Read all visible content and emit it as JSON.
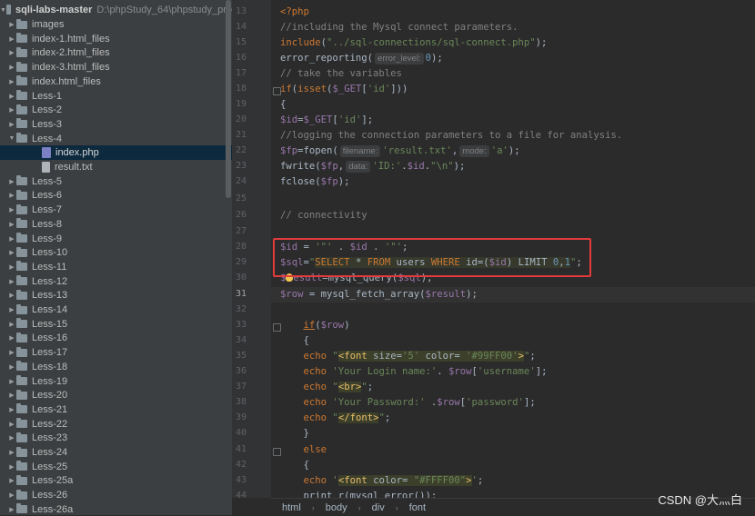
{
  "project": {
    "root_name": "sqli-labs-master",
    "root_path": "D:\\phpStudy_64\\phpstudy_pro",
    "items": [
      {
        "label": "images",
        "type": "folder"
      },
      {
        "label": "index-1.html_files",
        "type": "folder"
      },
      {
        "label": "index-2.html_files",
        "type": "folder"
      },
      {
        "label": "index-3.html_files",
        "type": "folder"
      },
      {
        "label": "index.html_files",
        "type": "folder"
      },
      {
        "label": "Less-1",
        "type": "folder"
      },
      {
        "label": "Less-2",
        "type": "folder"
      },
      {
        "label": "Less-3",
        "type": "folder"
      },
      {
        "label": "Less-4",
        "type": "folder-open"
      },
      {
        "label": "index.php",
        "type": "php",
        "selected": true
      },
      {
        "label": "result.txt",
        "type": "txt"
      },
      {
        "label": "Less-5",
        "type": "folder"
      },
      {
        "label": "Less-6",
        "type": "folder"
      },
      {
        "label": "Less-7",
        "type": "folder"
      },
      {
        "label": "Less-8",
        "type": "folder"
      },
      {
        "label": "Less-9",
        "type": "folder"
      },
      {
        "label": "Less-10",
        "type": "folder"
      },
      {
        "label": "Less-11",
        "type": "folder"
      },
      {
        "label": "Less-12",
        "type": "folder"
      },
      {
        "label": "Less-13",
        "type": "folder"
      },
      {
        "label": "Less-14",
        "type": "folder"
      },
      {
        "label": "Less-15",
        "type": "folder"
      },
      {
        "label": "Less-16",
        "type": "folder"
      },
      {
        "label": "Less-17",
        "type": "folder"
      },
      {
        "label": "Less-18",
        "type": "folder"
      },
      {
        "label": "Less-19",
        "type": "folder"
      },
      {
        "label": "Less-20",
        "type": "folder"
      },
      {
        "label": "Less-21",
        "type": "folder"
      },
      {
        "label": "Less-22",
        "type": "folder"
      },
      {
        "label": "Less-23",
        "type": "folder"
      },
      {
        "label": "Less-24",
        "type": "folder"
      },
      {
        "label": "Less-25",
        "type": "folder"
      },
      {
        "label": "Less-25a",
        "type": "folder"
      },
      {
        "label": "Less-26",
        "type": "folder"
      },
      {
        "label": "Less-26a",
        "type": "folder"
      }
    ]
  },
  "editor": {
    "line_numbers": [
      "13",
      "14",
      "15",
      "16",
      "17",
      "18",
      "19",
      "20",
      "21",
      "22",
      "23",
      "24",
      "25",
      "26",
      "27",
      "28",
      "29",
      "30",
      "31",
      "32",
      "33",
      "34",
      "35",
      "36",
      "37",
      "38",
      "39",
      "40",
      "41",
      "42",
      "43",
      "44"
    ],
    "current_line": "31",
    "hints": {
      "error_level": "error_level:",
      "filename": "filename:",
      "mode": "mode:",
      "data": "data:"
    }
  },
  "statusbar": {
    "crumbs": [
      "html",
      "body",
      "div",
      "font"
    ]
  },
  "watermark": "CSDN @大灬白",
  "colors": {
    "highlight_box": "#e33b3b",
    "selection": "#0d293e",
    "keyword": "#cc7832",
    "string": "#6a8759",
    "variable": "#9876aa"
  }
}
